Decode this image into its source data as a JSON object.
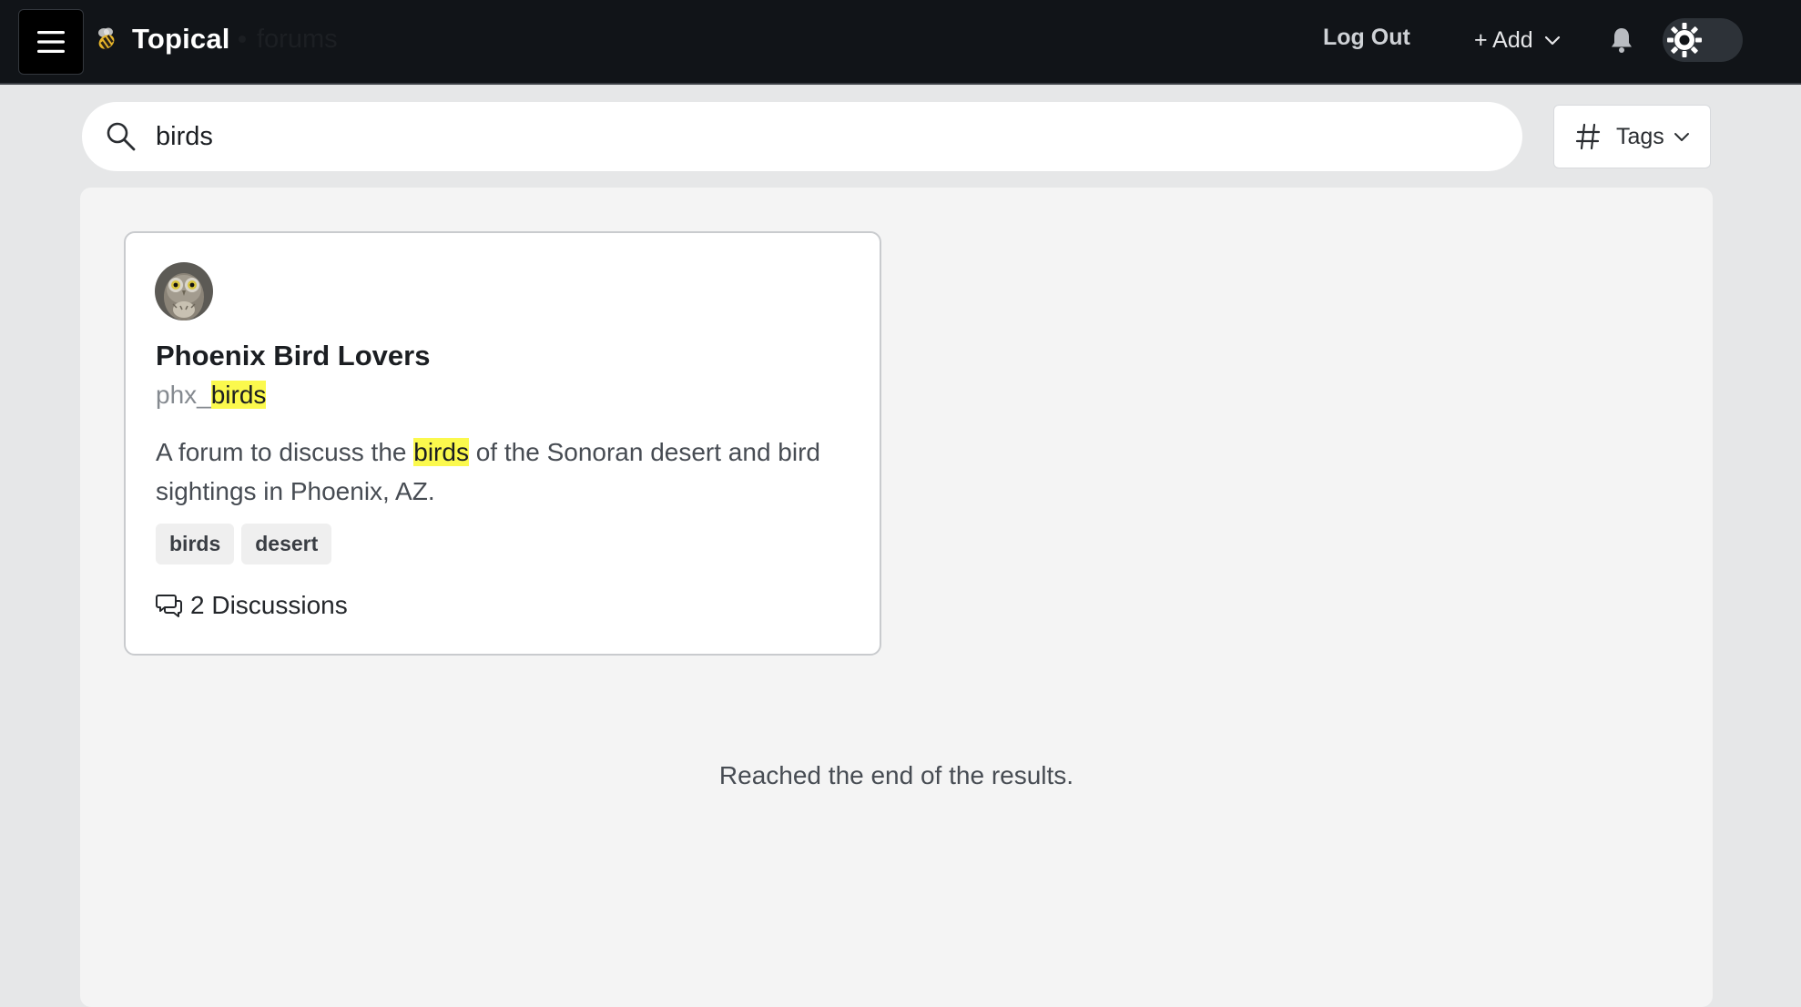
{
  "header": {
    "menu_icon": "hamburger-icon",
    "brand_icon": "bee-icon",
    "brand_name": "Topical",
    "section": "forums",
    "logout_label": "Log Out",
    "add_label": "+ Add",
    "add_dropdown_icon": "chevron-down-icon",
    "notifications_icon": "bell-icon",
    "theme_toggle_icon": "sun-icon"
  },
  "search": {
    "icon": "search-icon",
    "value": "birds",
    "tags_icon": "hash-icon",
    "tags_label": "Tags"
  },
  "results": [
    {
      "avatar": "owl-avatar",
      "title": "Phoenix Bird Lovers",
      "handle_prefix": "phx_",
      "handle_match": "birds",
      "desc_before": "A forum to discuss the ",
      "desc_match": "birds",
      "desc_after": " of the Sonoran desert and bird sightings in Phoenix, AZ.",
      "tags": [
        "birds",
        "desert"
      ],
      "discussions_label": "2 Discussions",
      "discussions_icon": "chat-bubbles-icon"
    }
  ],
  "end_message": "Reached the end of the results.",
  "colors": {
    "topbar": "#111418",
    "highlight": "#fbf94d",
    "page_bg": "#e6e7e8",
    "panel_bg": "#f4f4f4"
  }
}
